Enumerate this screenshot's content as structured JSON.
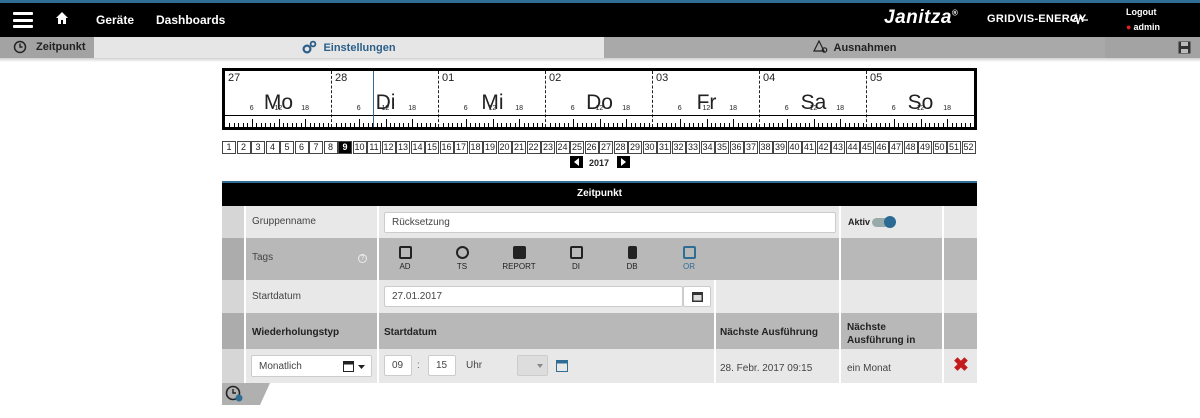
{
  "topbar": {
    "nav": [
      "Geräte",
      "Dashboards"
    ],
    "brand": "Janitza",
    "brand_mark": "®",
    "product": "GRIDVIS-ENERGY",
    "logout": "Logout",
    "user": "admin",
    "accent": "#2f6d95"
  },
  "tabs": {
    "zeitpunkt": "Zeitpunkt",
    "einstellungen": "Einstellungen",
    "ausnahmen": "Ausnahmen"
  },
  "calendar": {
    "days": [
      {
        "num": "27",
        "name": "Mo"
      },
      {
        "num": "28",
        "name": "Di"
      },
      {
        "num": "01",
        "name": "Mi"
      },
      {
        "num": "02",
        "name": "Do"
      },
      {
        "num": "03",
        "name": "Fr"
      },
      {
        "num": "04",
        "name": "Sa"
      },
      {
        "num": "05",
        "name": "So"
      }
    ],
    "hour_labels": [
      "6",
      "12",
      "18"
    ],
    "weeks": [
      "1",
      "2",
      "3",
      "4",
      "5",
      "6",
      "7",
      "8",
      "9",
      "10",
      "11",
      "12",
      "13",
      "14",
      "15",
      "16",
      "17",
      "18",
      "19",
      "20",
      "21",
      "22",
      "23",
      "24",
      "25",
      "26",
      "27",
      "28",
      "29",
      "30",
      "31",
      "32",
      "33",
      "34",
      "35",
      "36",
      "37",
      "38",
      "39",
      "40",
      "41",
      "42",
      "43",
      "44",
      "45",
      "46",
      "47",
      "48",
      "49",
      "50",
      "51",
      "52"
    ],
    "active_week": "9",
    "year": "2017"
  },
  "form": {
    "title": "Zeitpunkt",
    "gruppenname_label": "Gruppenname",
    "gruppenname_value": "Rücksetzung",
    "aktiv_label": "Aktiv",
    "tags_label": "Tags",
    "tags": [
      "AD",
      "TS",
      "REPORT",
      "DI",
      "DB",
      "OR"
    ],
    "startdatum_label": "Startdatum",
    "startdatum_value": "27.01.2017",
    "col_wiederholungstyp": "Wiederholungstyp",
    "col_startdatum": "Startdatum",
    "col_naechste": "Nächste Ausführung",
    "col_naechste_in": "Nächste Ausführung in",
    "wiederholung_value": "Monatlich",
    "hour": "09",
    "minute": "15",
    "uhr": "Uhr",
    "naechste_value": "28. Febr. 2017 09:15",
    "naechste_in_value": "ein Monat"
  }
}
